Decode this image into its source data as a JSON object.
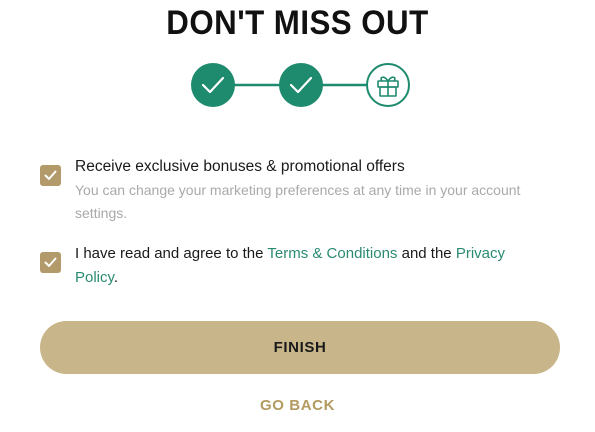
{
  "header": {
    "title": "DON'T MISS OUT"
  },
  "stepper": {
    "steps": [
      {
        "state": "complete",
        "icon": "check-icon"
      },
      {
        "state": "complete",
        "icon": "check-icon"
      },
      {
        "state": "current",
        "icon": "gift-icon"
      }
    ],
    "complete_color": "#1e8a6e",
    "connector_color": "#1e8a6e"
  },
  "marketing_consent": {
    "checked": true,
    "label": "Receive exclusive bonuses & promotional offers",
    "helper": "You can change your marketing preferences at any time in your account settings."
  },
  "terms_consent": {
    "checked": true,
    "prefix": "I have read and agree to the ",
    "terms_link": "Terms & Conditions",
    "middle": " and the ",
    "privacy_link": "Privacy Policy",
    "suffix": "."
  },
  "actions": {
    "finish_label": "FINISH",
    "go_back_label": "GO BACK"
  },
  "colors": {
    "accent_gold": "#c8b58a",
    "checkbox_gold": "#b29a6a",
    "link_green": "#2a8a72",
    "go_back_gold": "#b39b60"
  }
}
